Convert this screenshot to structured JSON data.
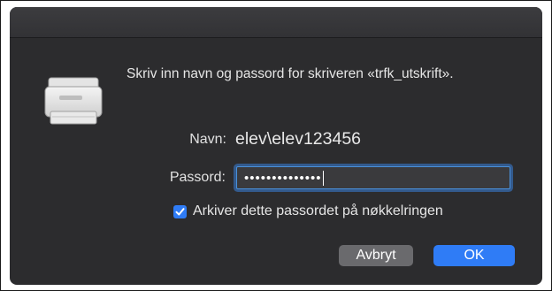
{
  "dialog": {
    "message": "Skriv inn navn og passord for skriveren «trfk_utskrift».",
    "icon": "printer-icon"
  },
  "name_field": {
    "label": "Navn:",
    "value": "elev\\elev123456"
  },
  "password_field": {
    "label": "Passord:",
    "masked_value": "••••••••••••••"
  },
  "remember_checkbox": {
    "checked": true,
    "label": "Arkiver dette passordet på nøkkelringen"
  },
  "buttons": {
    "cancel_label": "Avbryt",
    "ok_label": "OK"
  },
  "colors": {
    "dialog_bg": "#2c2c2e",
    "accent": "#2f7cf6",
    "cancel_button": "#6a6a6d"
  }
}
